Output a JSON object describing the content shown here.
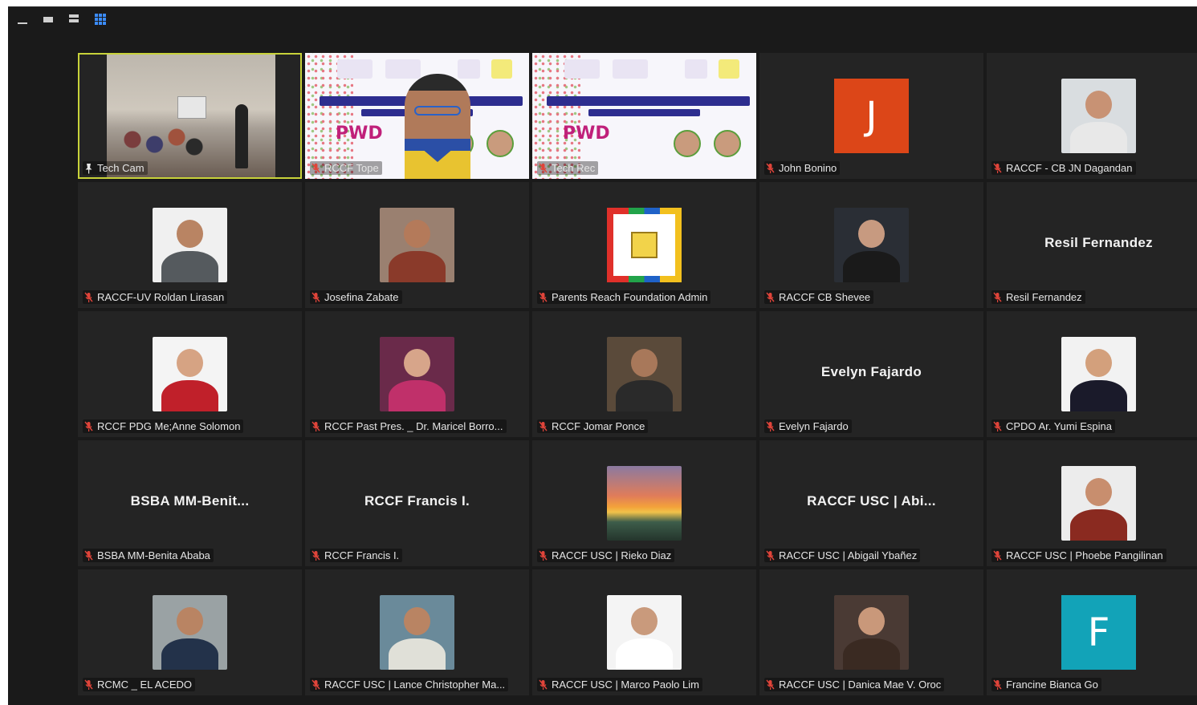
{
  "toolbar": {
    "buttons": [
      {
        "name": "minimize-view-icon"
      },
      {
        "name": "speaker-view-icon"
      },
      {
        "name": "strip-view-icon"
      },
      {
        "name": "gallery-view-icon",
        "active": true
      }
    ]
  },
  "colors": {
    "background": "#1a1a1a",
    "tile": "#242424",
    "active_border": "#c8d23a",
    "mute_red": "#e0443a",
    "gallery_accent": "#3b8cff",
    "letter_j_bg": "#dc4618",
    "letter_f_bg": "#12a3b8"
  },
  "participants": [
    {
      "id": "tech-cam",
      "label": "Tech Cam",
      "kind": "video-room",
      "pinned": true,
      "active": true
    },
    {
      "id": "rccf-tope",
      "label": "RCCF Tope",
      "kind": "shared-screen-overlay"
    },
    {
      "id": "tech-rec",
      "label": "Tech Rec",
      "kind": "shared-screen"
    },
    {
      "id": "john-bonino",
      "label": "John Bonino",
      "kind": "letter",
      "letter": "J",
      "letter_color": "#dc4618",
      "muted": true
    },
    {
      "id": "raccf-cb-jn-dagandan",
      "label": "RACCF - CB JN Dagandan",
      "kind": "photo",
      "skin": "#c89274",
      "shirt": "#e8e8e8",
      "bg": "#d9dde0",
      "muted": true
    },
    {
      "id": "raccf-uv-roldan-lirasan",
      "label": "RACCF-UV Roldan Lirasan",
      "kind": "photo",
      "skin": "#b98463",
      "shirt": "#555a5e",
      "bg": "#f0f0f0",
      "muted": true
    },
    {
      "id": "josefina-zabate",
      "label": "Josefina Zabate",
      "kind": "photo",
      "skin": "#b47a5a",
      "shirt": "#8a3a2a",
      "bg": "#9a8070",
      "muted": true
    },
    {
      "id": "parents-reach-foundation-admin",
      "label": "Parents Reach Foundation Admin",
      "kind": "logo-prf",
      "muted": true
    },
    {
      "id": "raccf-cb-shevee",
      "label": "RACCF CB Shevee",
      "kind": "photo",
      "skin": "#c79a80",
      "shirt": "#1a1a1a",
      "bg": "#2a2e35",
      "muted": true
    },
    {
      "id": "resil-fernandez",
      "label": "Resil Fernandez",
      "display": "Resil Fernandez",
      "kind": "name-only",
      "muted": true
    },
    {
      "id": "rccf-pdg-meanne-solomon",
      "label": "RCCF PDG Me;Anne Solomon",
      "kind": "photo",
      "skin": "#d6a383",
      "shirt": "#c0202a",
      "bg": "#f4f4f4",
      "muted": true
    },
    {
      "id": "rccf-past-pres-dr-maricel",
      "label": "RCCF Past Pres. _ Dr. Maricel Borro...",
      "kind": "photo",
      "skin": "#d7a58a",
      "shirt": "#c0306a",
      "bg": "#6a2a4a",
      "muted": true
    },
    {
      "id": "rccf-jomar-ponce",
      "label": "RCCF Jomar Ponce",
      "kind": "photo",
      "skin": "#a8785a",
      "shirt": "#2a2a2a",
      "bg": "#5a4a3a",
      "muted": true
    },
    {
      "id": "evelyn-fajardo",
      "label": "Evelyn Fajardo",
      "display": "Evelyn Fajardo",
      "kind": "name-only",
      "muted": true
    },
    {
      "id": "cpdo-ar-yumi-espina",
      "label": "CPDO Ar. Yumi Espina",
      "kind": "photo",
      "skin": "#d3a07c",
      "shirt": "#1a1a2a",
      "bg": "#f2f2f2",
      "muted": true
    },
    {
      "id": "bsba-mm-benita-ababa",
      "label": "BSBA MM-Benita Ababa",
      "display": "BSBA  MM-Benit...",
      "kind": "name-only",
      "muted": true
    },
    {
      "id": "rccf-francis-i",
      "label": "RCCF Francis I.",
      "display": "RCCF Francis I.",
      "kind": "name-only",
      "muted": true
    },
    {
      "id": "raccf-usc-rieko-diaz",
      "label": "RACCF USC | Rieko Diaz",
      "kind": "sunset",
      "muted": true
    },
    {
      "id": "raccf-usc-abigail-ybanez",
      "label": "RACCF USC | Abigail Ybañez",
      "display": "RACCF USC | Abi...",
      "kind": "name-only",
      "muted": true
    },
    {
      "id": "raccf-usc-phoebe-pangilinan",
      "label": "RACCF USC | Phoebe Pangilinan",
      "kind": "photo",
      "skin": "#c88e6e",
      "shirt": "#8a2a20",
      "bg": "#ececec",
      "muted": true
    },
    {
      "id": "rcmc-el-acedo",
      "label": "RCMC _ EL ACEDO",
      "kind": "photo",
      "skin": "#b98463",
      "shirt": "#23324a",
      "bg": "#9aa2a4",
      "muted": true
    },
    {
      "id": "raccf-usc-lance-christopher",
      "label": "RACCF USC | Lance Christopher Ma...",
      "kind": "photo",
      "skin": "#b98463",
      "shirt": "#e0e0d8",
      "bg": "#6a8a9a",
      "muted": true
    },
    {
      "id": "raccf-usc-marco-paolo-lim",
      "label": "RACCF USC | Marco Paolo Lim",
      "kind": "photo",
      "skin": "#c99a7c",
      "shirt": "#ffffff",
      "bg": "#f4f4f4",
      "muted": true
    },
    {
      "id": "raccf-usc-danica-mae-v-oroc",
      "label": "RACCF USC | Danica Mae V. Oroc",
      "kind": "photo",
      "skin": "#c9987a",
      "shirt": "#3a2a22",
      "bg": "#4a3a34",
      "muted": true
    },
    {
      "id": "francine-bianca-go",
      "label": "Francine Bianca Go",
      "kind": "letter",
      "letter": "F",
      "letter_color": "#12a3b8",
      "muted": true
    }
  ]
}
